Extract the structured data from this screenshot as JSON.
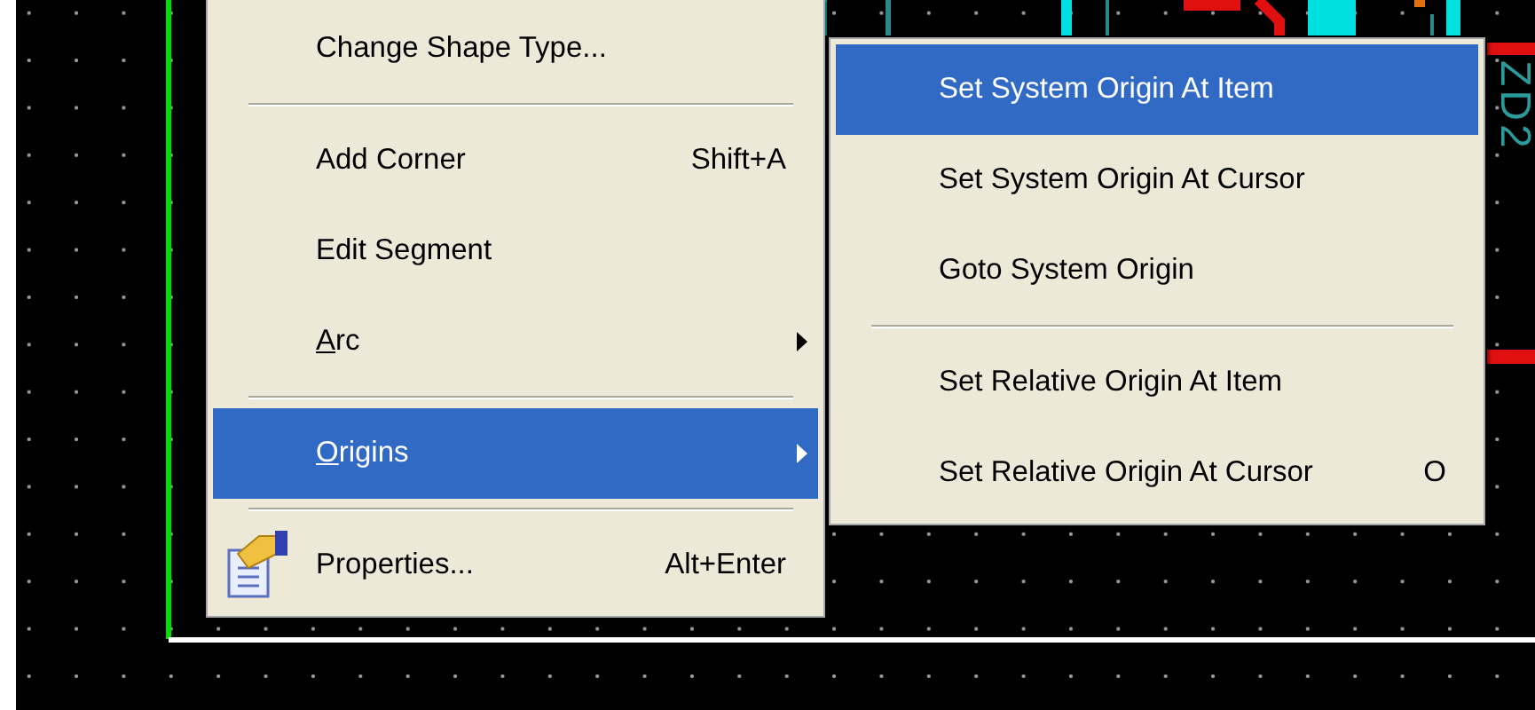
{
  "canvas": {
    "designator": "ZD2"
  },
  "context_menu": {
    "items": [
      {
        "kind": "item",
        "label": "Change Shape Type...",
        "selected": false
      },
      {
        "kind": "separator"
      },
      {
        "kind": "item",
        "label": "Add Corner",
        "shortcut": "Shift+A",
        "selected": false
      },
      {
        "kind": "item",
        "label": "Edit Segment",
        "selected": false
      },
      {
        "kind": "submenu",
        "label": "Arc",
        "selected": false
      },
      {
        "kind": "separator"
      },
      {
        "kind": "submenu",
        "label": "Origins",
        "selected": true
      },
      {
        "kind": "separator"
      },
      {
        "kind": "icon_item",
        "label": "Properties...",
        "shortcut": "Alt+Enter",
        "selected": false
      }
    ]
  },
  "submenu": {
    "items": [
      {
        "kind": "item",
        "label": "Set System Origin At Item",
        "selected": true
      },
      {
        "kind": "item",
        "label": "Set System Origin At Cursor",
        "selected": false
      },
      {
        "kind": "item",
        "label": "Goto System Origin",
        "selected": false
      },
      {
        "kind": "separator"
      },
      {
        "kind": "item",
        "label": "Set Relative Origin At Item",
        "selected": false
      },
      {
        "kind": "item",
        "label": "Set Relative Origin At Cursor",
        "shortcut": "O",
        "selected": false
      }
    ]
  }
}
